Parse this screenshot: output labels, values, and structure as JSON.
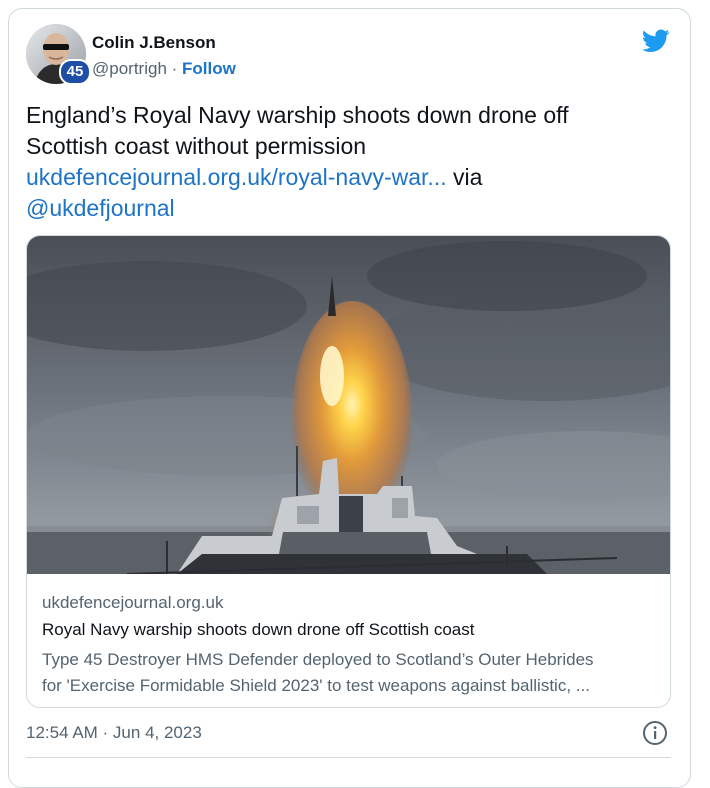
{
  "author": {
    "name": "Colin J.Benson",
    "handle": "@portrigh",
    "separator": " · ",
    "follow_label": "Follow",
    "badge": "45"
  },
  "icons": {
    "platform": "twitter-bird-icon",
    "info": "info-icon"
  },
  "colors": {
    "link": "#1d73c8",
    "twitter_blue": "#1d9bf0",
    "muted": "#536471",
    "badge": "#1f4ea8"
  },
  "tweet": {
    "text_line1": "England’s Royal Navy warship shoots down drone off",
    "text_line2": "Scottish coast without permission",
    "link_text": "ukdefencejournal.org.uk/royal-navy-war...",
    "via": " via",
    "mention": "@ukdefjournal"
  },
  "link_card": {
    "domain": "ukdefencejournal.org.uk",
    "title": "Royal Navy warship shoots down drone off Scottish coast",
    "desc_line1": "Type 45 Destroyer HMS Defender deployed to Scotland’s Outer Hebrides",
    "desc_line2": "for 'Exercise Formidable Shield 2023' to test weapons against ballistic, ..."
  },
  "footer": {
    "timestamp": "12:54 AM · Jun 4, 2023"
  }
}
